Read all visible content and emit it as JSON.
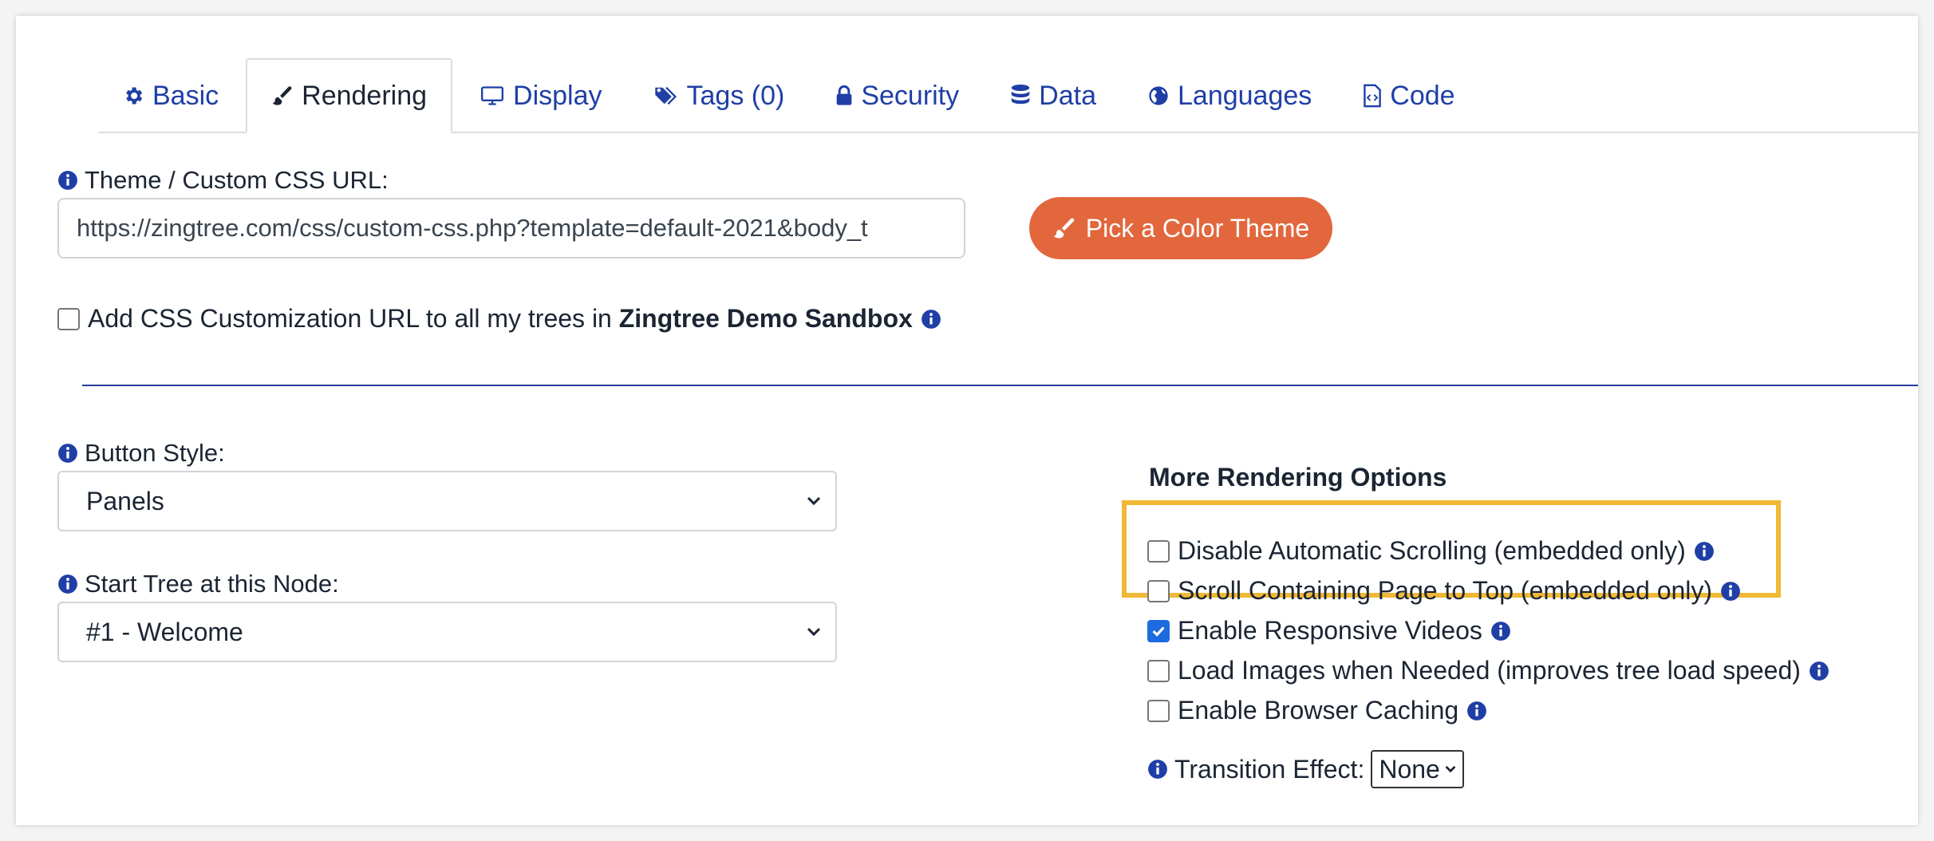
{
  "tabs": [
    {
      "label": "Basic",
      "icon": "gear-icon"
    },
    {
      "label": "Rendering",
      "icon": "paintbrush-icon"
    },
    {
      "label": "Display",
      "icon": "monitor-icon"
    },
    {
      "label": "Tags (0)",
      "icon": "tags-icon"
    },
    {
      "label": "Security",
      "icon": "lock-icon"
    },
    {
      "label": "Data",
      "icon": "database-icon"
    },
    {
      "label": "Languages",
      "icon": "globe-icon"
    },
    {
      "label": "Code",
      "icon": "code-file-icon"
    }
  ],
  "active_tab": "Rendering",
  "theme": {
    "label": "Theme / Custom CSS URL:",
    "url_value": "https://zingtree.com/css/custom-css.php?template=default-2021&body_t",
    "pick_button_label": "Pick a Color Theme",
    "apply_all_prefix": "Add CSS Customization URL to all my trees in ",
    "apply_all_org": "Zingtree Demo Sandbox",
    "apply_all_checked": false
  },
  "button_style": {
    "label": "Button Style:",
    "value": "Panels"
  },
  "start_node": {
    "label": "Start Tree at this Node:",
    "value": "#1 - Welcome"
  },
  "more_options": {
    "title": "More Rendering Options",
    "options": [
      {
        "label": "Disable Automatic Scrolling (embedded only)",
        "checked": false
      },
      {
        "label": "Scroll Containing Page to Top (embedded only)",
        "checked": false
      },
      {
        "label": "Enable Responsive Videos",
        "checked": true
      },
      {
        "label": "Load Images when Needed (improves tree load speed)",
        "checked": false
      },
      {
        "label": "Enable Browser Caching",
        "checked": false
      }
    ],
    "transition_label": "Transition Effect:",
    "transition_value": "None"
  },
  "colors": {
    "accent_blue": "#1f3fa6",
    "button_orange": "#e2673d",
    "highlight_yellow": "#f0b935",
    "checkbox_blue": "#1e6be0"
  }
}
